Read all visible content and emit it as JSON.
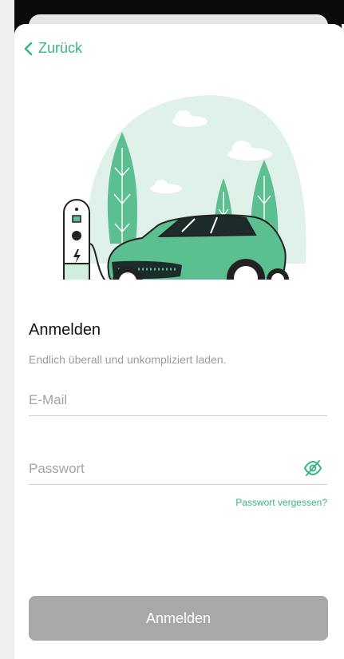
{
  "nav": {
    "back_label": "Zurück"
  },
  "login": {
    "title": "Anmelden",
    "subtitle": "Endlich überall und unkompliziert laden.",
    "email_placeholder": "E-Mail",
    "password_placeholder": "Passwort",
    "forgot_label": "Passwort vergessen?",
    "submit_label": "Anmelden"
  },
  "colors": {
    "accent": "#3bb581",
    "button_disabled": "#a6a8a9",
    "illustration_green": "#5cbf92",
    "illustration_bg": "#dff1e8"
  },
  "icons": {
    "back": "chevron-left-icon",
    "password_toggle": "eye-off-icon",
    "illustration": "electric-car-charging-illustration"
  }
}
